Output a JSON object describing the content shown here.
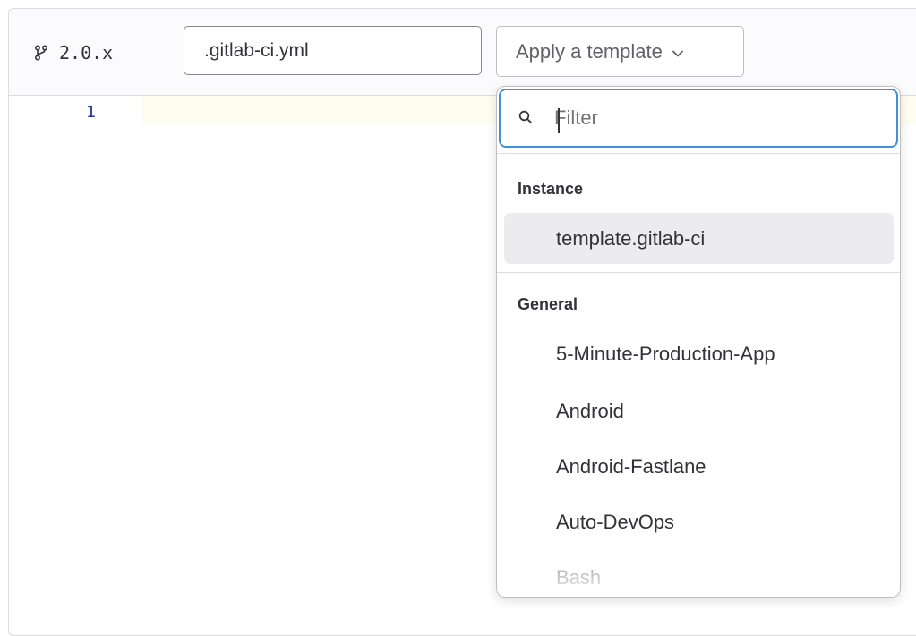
{
  "toolbar": {
    "branch_icon": "branch-icon",
    "branch_name": "2.0.x",
    "filename_value": ".gitlab-ci.yml",
    "template_button_label": "Apply a template",
    "template_button_icon": "chevron-down-icon"
  },
  "editor": {
    "line_numbers": [
      "1"
    ]
  },
  "dropdown": {
    "search": {
      "icon": "search-icon",
      "placeholder": "Filter"
    },
    "groups": [
      {
        "header": "Instance",
        "items": [
          {
            "label": "template.gitlab-ci",
            "selected": true
          }
        ]
      },
      {
        "header": "General",
        "items": [
          {
            "label": "5-Minute-Production-App"
          },
          {
            "label": "Android"
          },
          {
            "label": "Android-Fastlane"
          },
          {
            "label": "Auto-DevOps"
          },
          {
            "label": "Bash"
          }
        ]
      }
    ]
  },
  "colors": {
    "focus_border": "#428fdc",
    "selected_item_bg": "#ececef",
    "current_line_bg": "#fffdf0",
    "line_number": "#1f2f8a"
  }
}
